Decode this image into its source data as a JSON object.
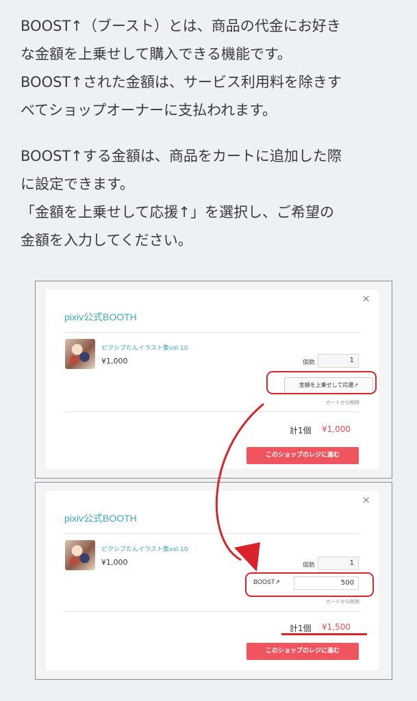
{
  "intro": {
    "paragraphs": [
      [
        "BOOST↑（ブースト）とは、商品の代金にお好き",
        "な金額を上乗せして購入できる機能です。",
        "BOOST↑された金額は、サービス利用料を除きす",
        "べてショップオーナーに支払われます。"
      ],
      [
        "BOOST↑する金額は、商品をカートに追加した際",
        "に設定できます。",
        "「金額を上乗せして応援↑」を選択し、ご希望の",
        "金額を入力してください。"
      ]
    ]
  },
  "screen1": {
    "close": "×",
    "shop_title": "pixiv公式BOOTH",
    "product_name": "ピクシブたんイラスト集vol.10",
    "product_price": "¥1,000",
    "qty_label": "個数",
    "qty_value": "1",
    "boost_button": "金額を上乗せして応援↗",
    "remove": "カートから削除",
    "total_label": "計1個",
    "total_price": "¥1,000",
    "checkout": "このショップのレジに進む"
  },
  "screen2": {
    "close": "×",
    "shop_title": "pixiv公式BOOTH",
    "product_name": "ピクシブたんイラスト集vol.10",
    "product_price": "¥1,000",
    "qty_label": "個数",
    "qty_value": "1",
    "boost_label": "BOOST↗",
    "boost_value": "500",
    "remove": "カートから削除",
    "total_label": "計1個",
    "total_price": "¥1,500",
    "checkout": "このショップのレジに進む"
  },
  "colors": {
    "accent": "#3aa7ba",
    "price_red": "#e44d57",
    "checkout_bg": "#f0555f",
    "highlight": "#d8232a"
  }
}
